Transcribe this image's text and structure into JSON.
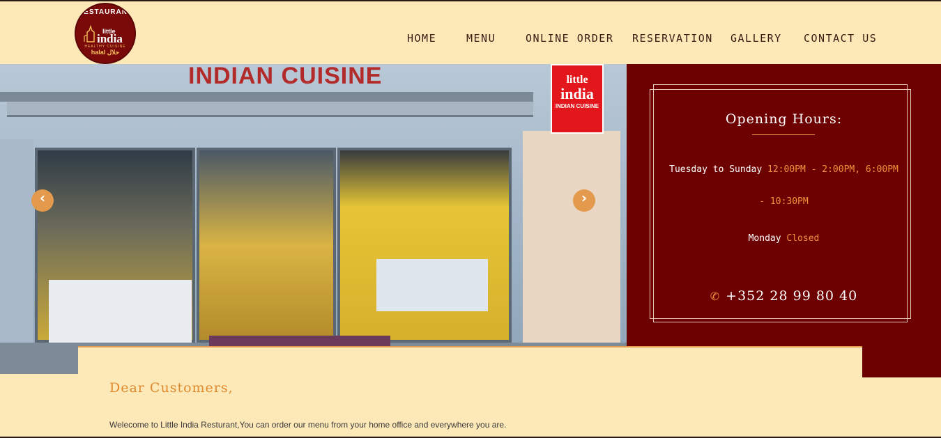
{
  "logo": {
    "arc_text": "RESTAURANT",
    "little": "little",
    "india": "india",
    "tagline": "HEALTHY CUISINE",
    "halal": "halal حلال"
  },
  "nav": {
    "items": [
      {
        "label": "HOME"
      },
      {
        "label": "MENU"
      },
      {
        "label": "ONLINE ORDER"
      },
      {
        "label": "RESERVATION"
      },
      {
        "label": "GALLERY"
      },
      {
        "label": "CONTACT US"
      }
    ]
  },
  "hero": {
    "sign_text": "INDIAN CUISINE",
    "lightbox": {
      "line1": "little",
      "line2": "india",
      "line3": "INDIAN CUISINE"
    },
    "prev_icon": "chevron-left-icon",
    "next_icon": "chevron-right-icon"
  },
  "hours": {
    "title": "Opening Hours:",
    "days_label": "Tuesday to Sunday",
    "days_times_a": "12:00PM - 2:00PM, 6:00PM",
    "days_times_b": "- 10:30PM",
    "closed_day": "Monday",
    "closed_label": "Closed",
    "phone_icon": "phone-icon",
    "phone": "+352 28 99 80 40"
  },
  "welcome": {
    "heading": "Dear Customers,",
    "text": "Welecome to Little India Resturant,You can order our menu from your home office and everywhere you are."
  },
  "colors": {
    "background": "#fde8b8",
    "maroon": "#6d0000",
    "accent": "#e39a4c",
    "nav_text": "#3a1a12"
  }
}
